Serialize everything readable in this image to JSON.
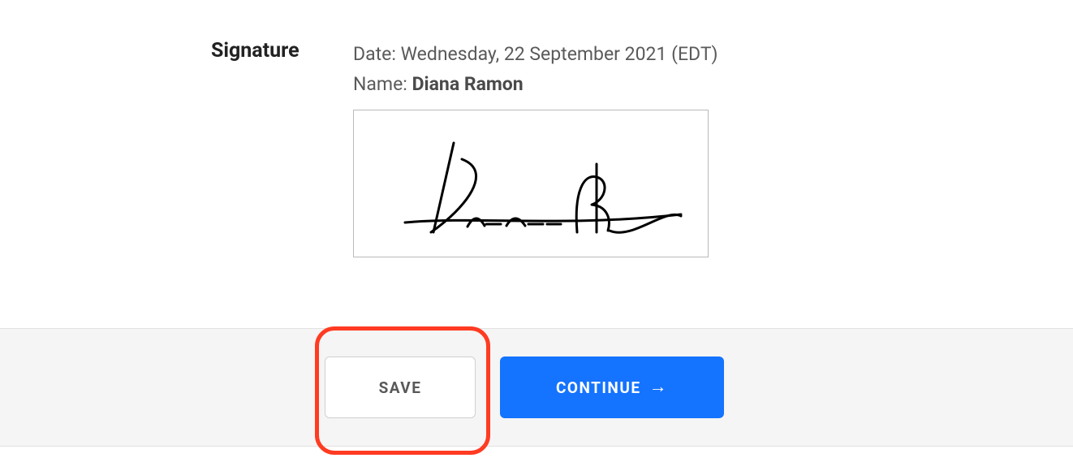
{
  "signature": {
    "heading": "Signature",
    "date_label": "Date:",
    "date_value": "Wednesday, 22 September 2021 (EDT)",
    "name_label": "Name:",
    "name_value": "Diana Ramon"
  },
  "buttons": {
    "save": "SAVE",
    "continue": "CONTINUE"
  },
  "icons": {
    "arrow_right": "→"
  },
  "colors": {
    "primary": "#1473ff",
    "highlight": "#ff3b22"
  }
}
